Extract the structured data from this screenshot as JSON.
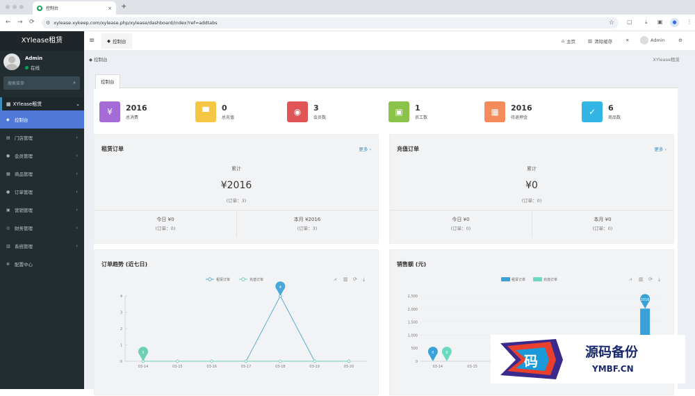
{
  "browser": {
    "tab_title": "控制台",
    "tab_close": "×",
    "new_tab": "+",
    "url": "xylease.xykeep.com/xylease.php/xylease/dashboard/index?ref=addtabs",
    "back": "←",
    "forward": "→",
    "reload": "⟳",
    "star": "☆"
  },
  "sidebar": {
    "brand": "XYlease租赁",
    "user_name": "Admin",
    "user_status": "在线",
    "search_placeholder": "搜索菜单",
    "menu_header": "XYlease租赁",
    "items": [
      {
        "label": "控制台",
        "icon": "◆"
      },
      {
        "label": "门店管理",
        "icon": "▤"
      },
      {
        "label": "会员管理",
        "icon": "●"
      },
      {
        "label": "商品管理",
        "icon": "▦"
      },
      {
        "label": "订单管理",
        "icon": "●"
      },
      {
        "label": "营销管理",
        "icon": "▣"
      },
      {
        "label": "财务管理",
        "icon": "◎"
      },
      {
        "label": "系统管理",
        "icon": "▥"
      },
      {
        "label": "配置中心",
        "icon": "✻"
      }
    ]
  },
  "topbar": {
    "tab": "控制台",
    "home": "主页",
    "clear_cache": "清除缓存",
    "user": "Admin"
  },
  "content": {
    "breadcrumb": "控制台",
    "breadcrumb_right": "XYlease租赁",
    "panel_tab": "控制台"
  },
  "stats": [
    {
      "value": "2016",
      "label": "总消费",
      "color": "#a56cd8",
      "icon": "¥"
    },
    {
      "value": "0",
      "label": "总充值",
      "color": "#f5c744",
      "icon": "▀"
    },
    {
      "value": "3",
      "label": "会员数",
      "color": "#e05555",
      "icon": "◉"
    },
    {
      "value": "1",
      "label": "员工数",
      "color": "#8bc34a",
      "icon": "▣"
    },
    {
      "value": "2016",
      "label": "待退押金",
      "color": "#f58a5a",
      "icon": "▦"
    },
    {
      "value": "6",
      "label": "商品数",
      "color": "#33b5e5",
      "icon": "✓"
    }
  ],
  "rent_card": {
    "title": "租赁订单",
    "more": "更多 ›",
    "total_label": "累计",
    "total_amount": "¥2016",
    "total_orders": "(订单：3)",
    "today_label": "今日 ¥0",
    "today_orders": "(订单：0)",
    "month_label": "本月 ¥2016",
    "month_orders": "(订单：3)"
  },
  "recharge_card": {
    "title": "充值订单",
    "more": "更多 ›",
    "total_label": "累计",
    "total_amount": "¥0",
    "total_orders": "(订单：0)",
    "today_label": "今日 ¥0",
    "today_orders": "(订单：0)",
    "month_label": "本月 ¥0",
    "month_orders": "(订单：0)"
  },
  "trend_card": {
    "title": "订单趋势 (近七日)"
  },
  "sales_card": {
    "title": "销售额 (元)"
  },
  "watermark": {
    "title": "源码备份",
    "sub": "YMBF.CN",
    "glyph": "码"
  },
  "chart_data": [
    {
      "type": "line",
      "categories": [
        "03-14",
        "03-15",
        "03-16",
        "03-17",
        "03-18",
        "03-19",
        "03-20"
      ],
      "series": [
        {
          "name": "租赁订单",
          "values": [
            0,
            0,
            0,
            0,
            4,
            0,
            0
          ]
        },
        {
          "name": "充值订单",
          "values": [
            0,
            0,
            0,
            0,
            0,
            0,
            0
          ]
        }
      ],
      "ylim": [
        0,
        4
      ],
      "yticks": [
        "0",
        "1",
        "2",
        "3",
        "4"
      ],
      "markers": [
        "0",
        "4"
      ],
      "legend": "top"
    },
    {
      "type": "bar",
      "categories": [
        "03-14",
        "03-15"
      ],
      "series": [
        {
          "name": "租赁订单",
          "values": [
            0,
            0,
            0,
            0,
            0,
            0,
            2016
          ]
        },
        {
          "name": "充值订单",
          "values": [
            0,
            0,
            0,
            0,
            0,
            0,
            0
          ]
        }
      ],
      "ylim": [
        0,
        2500
      ],
      "yticks": [
        "0",
        "500",
        "1,000",
        "1,500",
        "2,000",
        "2,500"
      ],
      "markers": [
        "0",
        "0",
        "2016"
      ],
      "legend": "top"
    }
  ]
}
